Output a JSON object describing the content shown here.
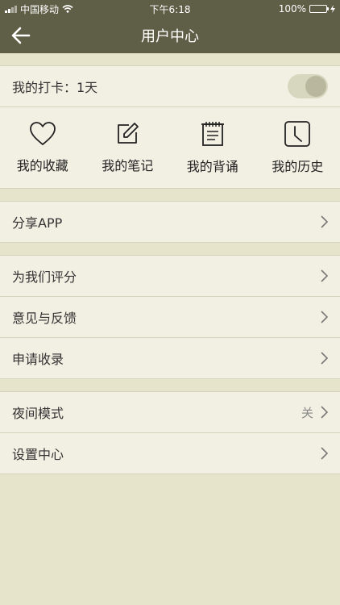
{
  "status_bar": {
    "carrier": "中国移动",
    "time": "下午6:18",
    "battery_percent": "100%",
    "battery_level": 1.0
  },
  "nav": {
    "title": "用户中心",
    "back_icon": "arrow-left-icon"
  },
  "checkin": {
    "label": "我的打卡：1天",
    "toggle_on": true
  },
  "quick_actions": [
    {
      "label": "我的收藏",
      "icon": "heart-icon"
    },
    {
      "label": "我的笔记",
      "icon": "note-edit-icon"
    },
    {
      "label": "我的背诵",
      "icon": "scroll-icon"
    },
    {
      "label": "我的历史",
      "icon": "clock-icon"
    }
  ],
  "section_share": [
    {
      "label": "分享APP"
    }
  ],
  "section_feedback": [
    {
      "label": "为我们评分"
    },
    {
      "label": "意见与反馈"
    },
    {
      "label": "申请收录"
    }
  ],
  "section_settings": [
    {
      "label": "夜间模式",
      "value": "关"
    },
    {
      "label": "设置中心"
    }
  ],
  "colors": {
    "header": "#5f5e47",
    "page_bg": "#e6e4cb",
    "card_bg": "#f2efe3",
    "battery": "#4cd964"
  }
}
